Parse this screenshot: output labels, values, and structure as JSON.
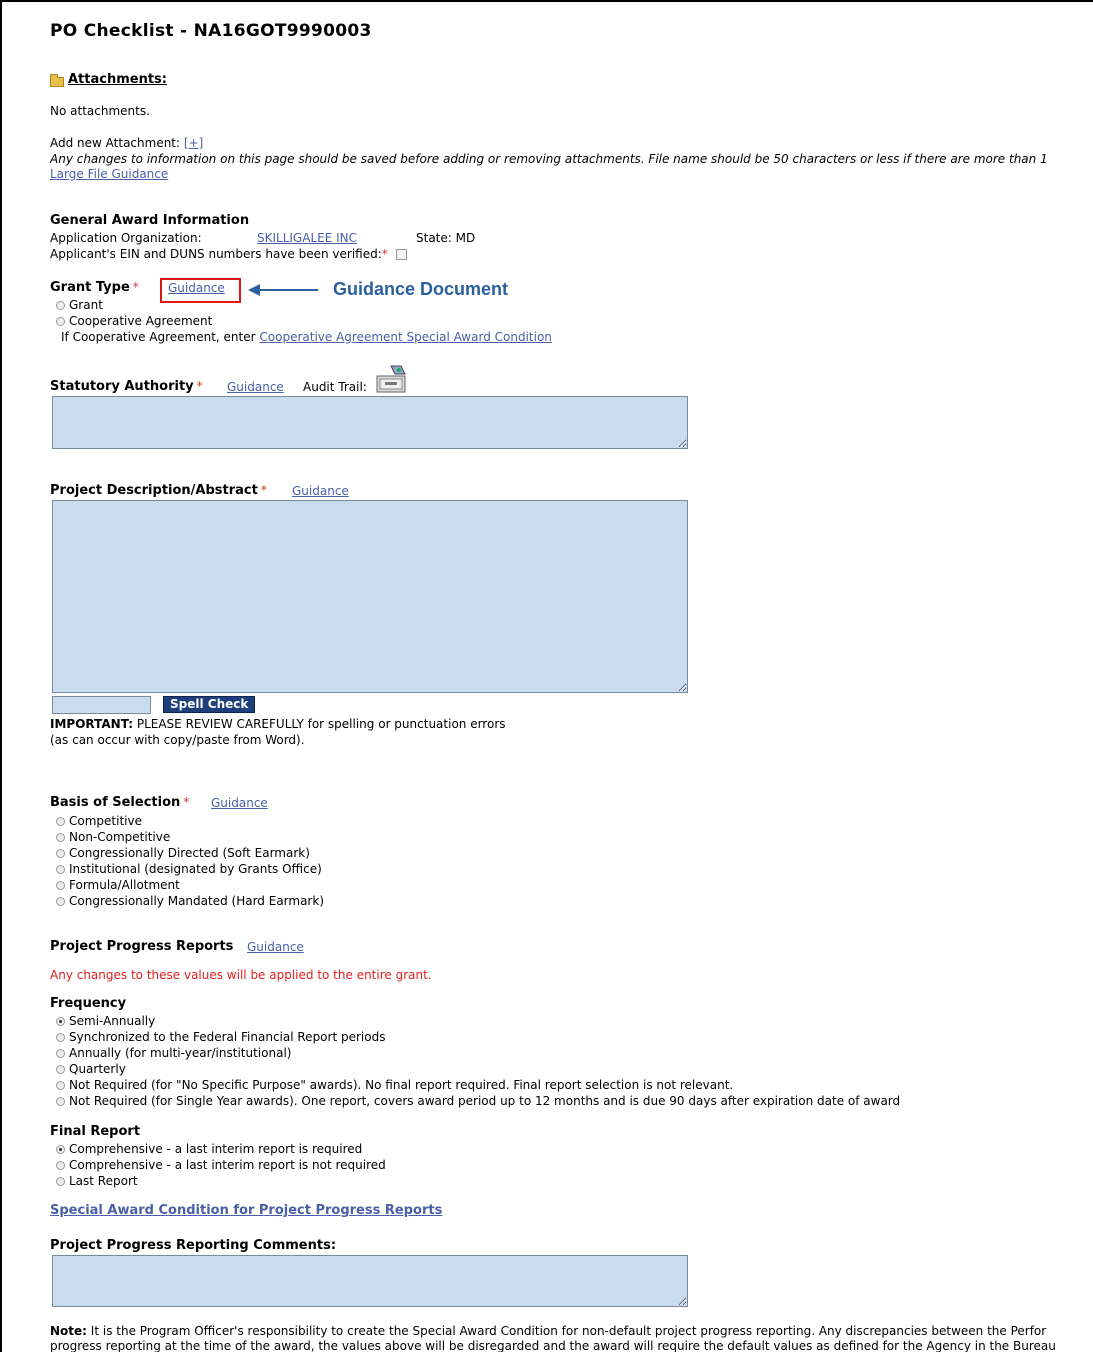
{
  "page": {
    "title": "PO Checklist - NA16GOT9990003"
  },
  "attachments": {
    "icon": "folder-icon",
    "heading": "Attachments:",
    "none_text": "No attachments.",
    "add_label": "Add new Attachment:",
    "add_link": "[+]",
    "notice": "Any changes to information on this page should be saved before adding or removing attachments. File name should be 50 characters or less if there are more than 1",
    "large_file_link": "Large File Guidance"
  },
  "general": {
    "heading": "General Award Information",
    "app_org_label": "Application Organization:",
    "app_org_value": "SKILLIGALEE INC",
    "state_label": "State:",
    "state_value": "MD",
    "verified_label": "Applicant's EIN and DUNS numbers have been verified:"
  },
  "grant_type": {
    "label": "Grant Type",
    "required": "*",
    "guidance": "Guidance",
    "options": [
      "Grant",
      "Cooperative Agreement"
    ],
    "coop_prefix": "If Cooperative Agreement, enter",
    "coop_link": "Cooperative Agreement Special Award Condition"
  },
  "annotation": {
    "text": "Guidance Document",
    "color": "#2c5fa0"
  },
  "statutory": {
    "label": "Statutory Authority",
    "required": "*",
    "guidance": "Guidance",
    "audit_label": "Audit Trail:",
    "audit_icon": "audit-trail-icon"
  },
  "project_desc": {
    "label": "Project Description/Abstract",
    "required": "*",
    "guidance": "Guidance",
    "spell_check": "Spell Check",
    "important_bold": "IMPORTANT:",
    "important_text": "PLEASE REVIEW CAREFULLY for spelling or punctuation errors",
    "important_text2": "(as can occur with copy/paste from Word)."
  },
  "basis": {
    "label": "Basis of Selection",
    "required": "*",
    "guidance": "Guidance",
    "options": [
      "Competitive",
      "Non-Competitive",
      "Congressionally Directed (Soft Earmark)",
      "Institutional (designated by Grants Office)",
      "Formula/Allotment",
      "Congressionally Mandated (Hard Earmark)"
    ]
  },
  "progress": {
    "label": "Project Progress Reports",
    "guidance": "Guidance",
    "warning": "Any changes to these values will be applied to the entire grant.",
    "frequency_label": "Frequency",
    "frequency_options": [
      "Semi-Annually",
      "Synchronized to the Federal Financial Report periods",
      "Annually (for multi-year/institutional)",
      "Quarterly",
      "Not Required (for \"No Specific Purpose\" awards). No final report required. Final report selection is not relevant.",
      "Not Required (for Single Year awards). One report, covers award period up to 12 months and is due 90 days after expiration date of award"
    ],
    "frequency_selected": 0,
    "final_label": "Final Report",
    "final_options": [
      "Comprehensive - a last interim report is required",
      "Comprehensive - a last interim report is not required",
      "Last Report"
    ],
    "final_selected": 0,
    "special_link": "Special Award Condition for Project Progress Reports",
    "comments_label": "Project Progress Reporting Comments:"
  },
  "note": {
    "bold": "Note:",
    "line1": "It is the Program Officer's responsibility to create the Special Award Condition for non-default project progress reporting. Any discrepancies between the Perfor",
    "line2": "progress reporting at the time of the award, the values above will be disregarded and the award will require the default values as defined for the Agency in the Bureau"
  }
}
